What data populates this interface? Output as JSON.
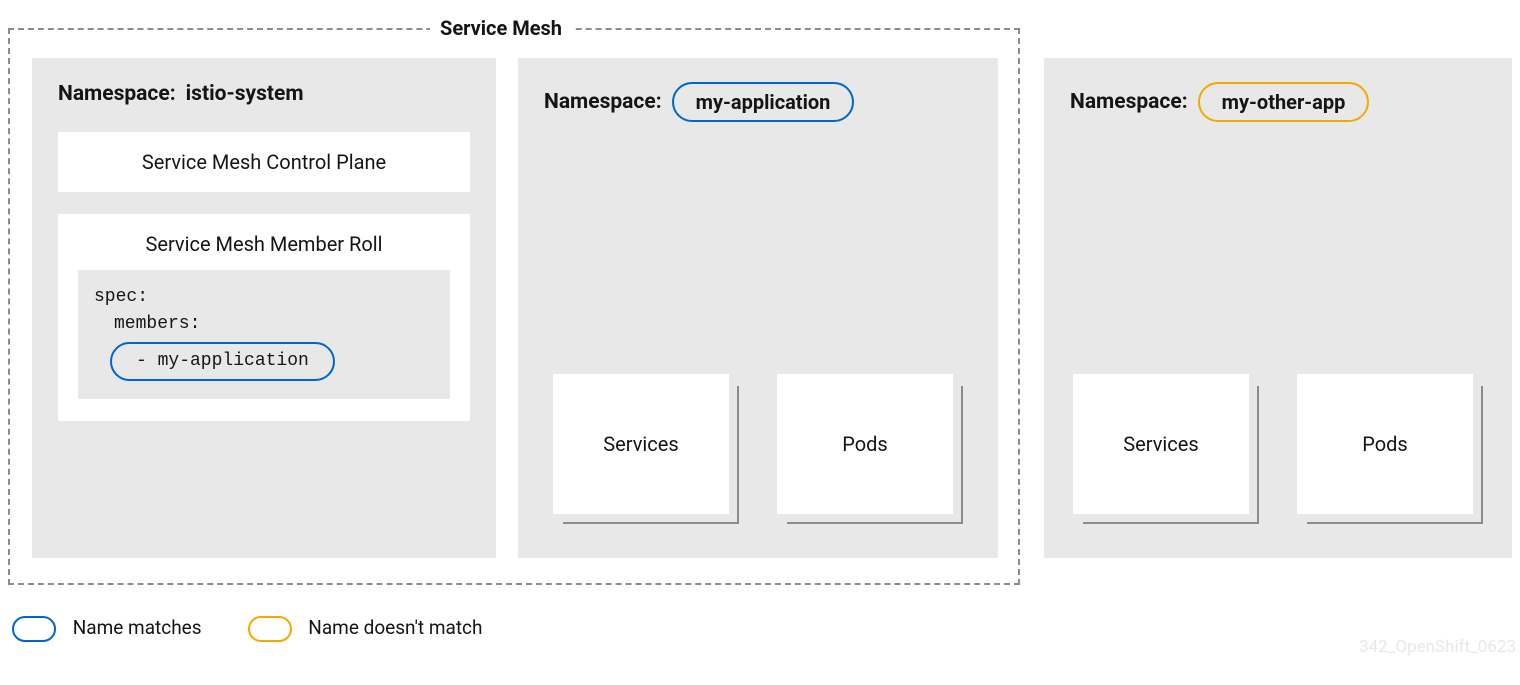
{
  "mesh": {
    "title": "Service Mesh"
  },
  "istio": {
    "prefix": "Namespace:",
    "name": "istio-system",
    "control_plane": "Service Mesh Control Plane",
    "member_roll_title": "Service Mesh Member Roll",
    "spec_line1": "spec:",
    "spec_line2": "members:",
    "spec_member": "- my-application"
  },
  "app": {
    "prefix": "Namespace:",
    "name": "my-application",
    "services": "Services",
    "pods": "Pods"
  },
  "other": {
    "prefix": "Namespace:",
    "name": "my-other-app",
    "services": "Services",
    "pods": "Pods"
  },
  "legend": {
    "match": "Name matches",
    "nomatch": "Name doesn't match"
  },
  "watermark": "342_OpenShift_0623",
  "colors": {
    "blue": "#0066cc",
    "orange": "#f0ab00",
    "grey": "#e8e8e8"
  }
}
